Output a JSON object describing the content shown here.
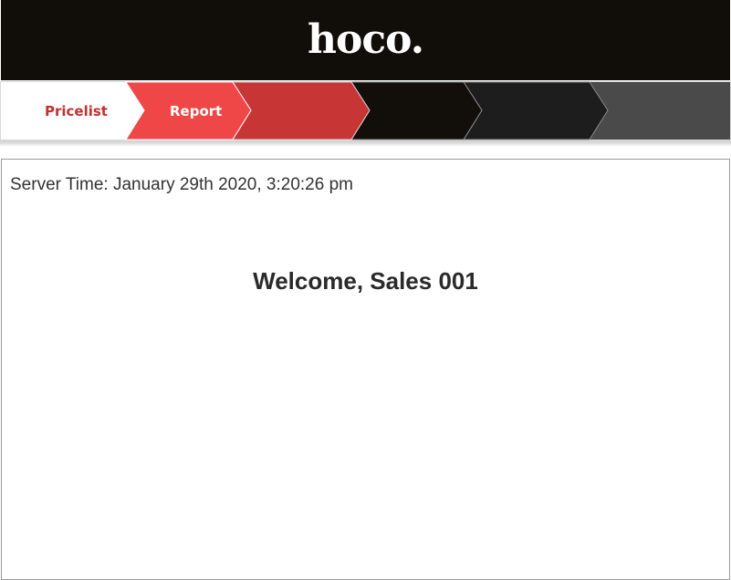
{
  "header": {
    "logo_text": "hoco."
  },
  "nav": {
    "items": [
      {
        "label": "Pricelist",
        "color": "#ffffff"
      },
      {
        "label": "Report",
        "color": "#ef4747"
      },
      {
        "label": "",
        "color": "#c83535"
      },
      {
        "label": "",
        "color": "#120e0a"
      },
      {
        "label": "",
        "color": "#1e1d1d"
      },
      {
        "label": "",
        "color": "#4a4a4a"
      }
    ]
  },
  "main": {
    "server_time": "Server Time: January 29th 2020, 3:20:26 pm",
    "welcome": "Welcome, Sales 001"
  },
  "colors": {
    "header_bg": "#110d09",
    "accent_red": "#c0312f"
  }
}
